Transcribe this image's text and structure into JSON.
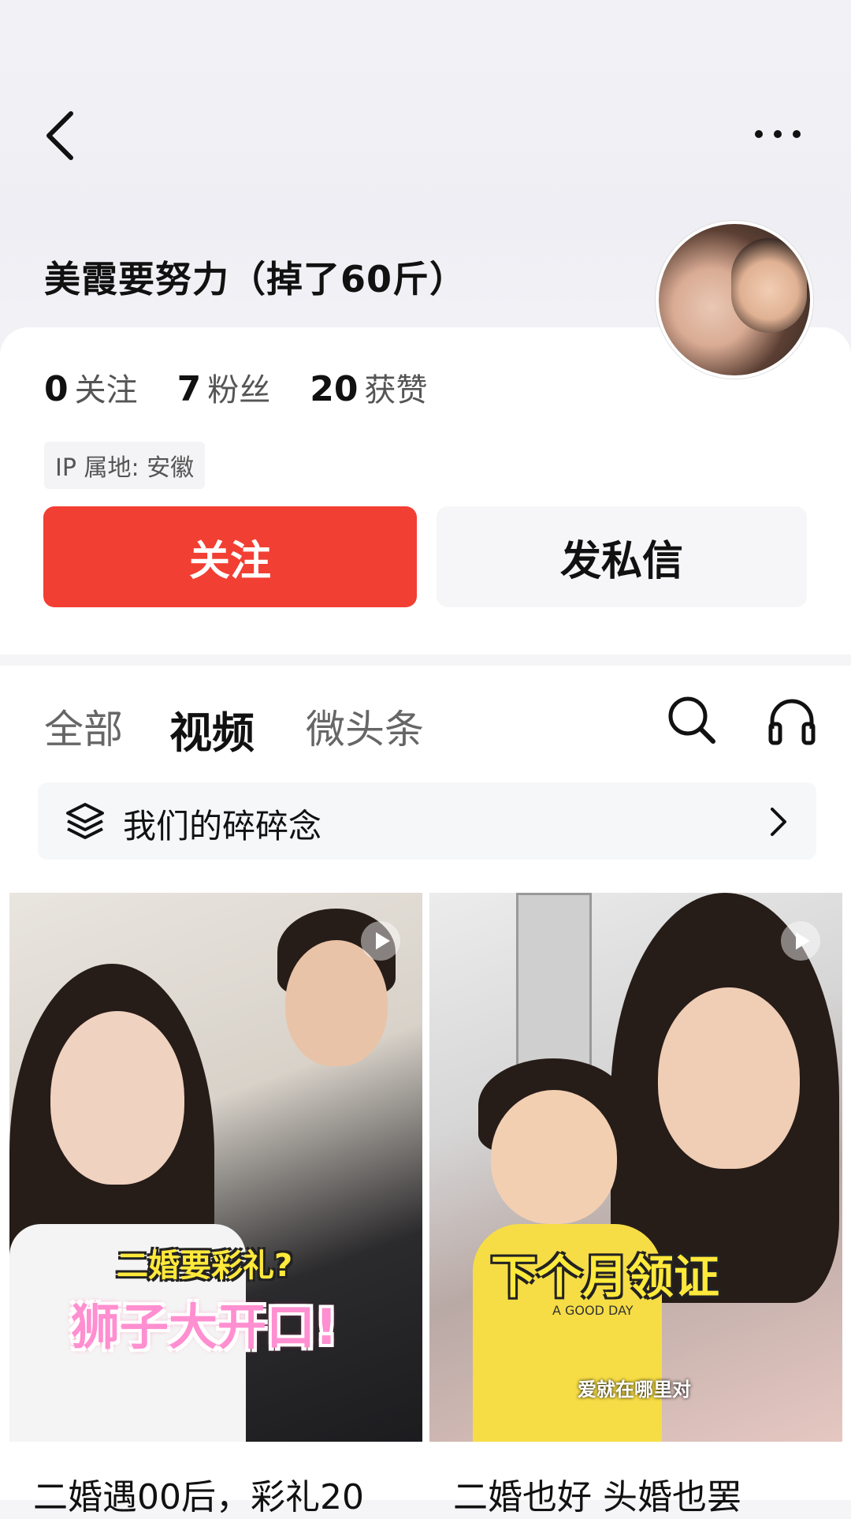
{
  "header": {
    "profile_name": "美霞要努力（掉了60斤）"
  },
  "stats": [
    {
      "count": "0",
      "label": "关注"
    },
    {
      "count": "7",
      "label": "粉丝"
    },
    {
      "count": "20",
      "label": "获赞"
    }
  ],
  "ip_location": "IP 属地: 安徽",
  "actions": {
    "follow_label": "关注",
    "message_label": "发私信"
  },
  "tabs": [
    {
      "label": "全部",
      "active": false
    },
    {
      "label": "视频",
      "active": true
    },
    {
      "label": "微头条",
      "active": false
    }
  ],
  "collection": {
    "label": "我们的碎碎念"
  },
  "videos": [
    {
      "caption_top": "二婚要彩礼?",
      "caption_main": "狮子大开口!",
      "title": "二婚遇00后，彩礼20"
    },
    {
      "caption_main": "下个月领证",
      "caption_sub": "爱就在哪里对",
      "shirt_text": "A GOOD DAY",
      "title": "二婚也好 头婚也罢"
    }
  ],
  "colors": {
    "follow_button": "#f23f33",
    "background": "#f5f5f7"
  },
  "icons": [
    "back-icon",
    "more-icon",
    "search-icon",
    "headphones-icon",
    "layers-icon",
    "chevron-right-icon",
    "play-icon"
  ]
}
